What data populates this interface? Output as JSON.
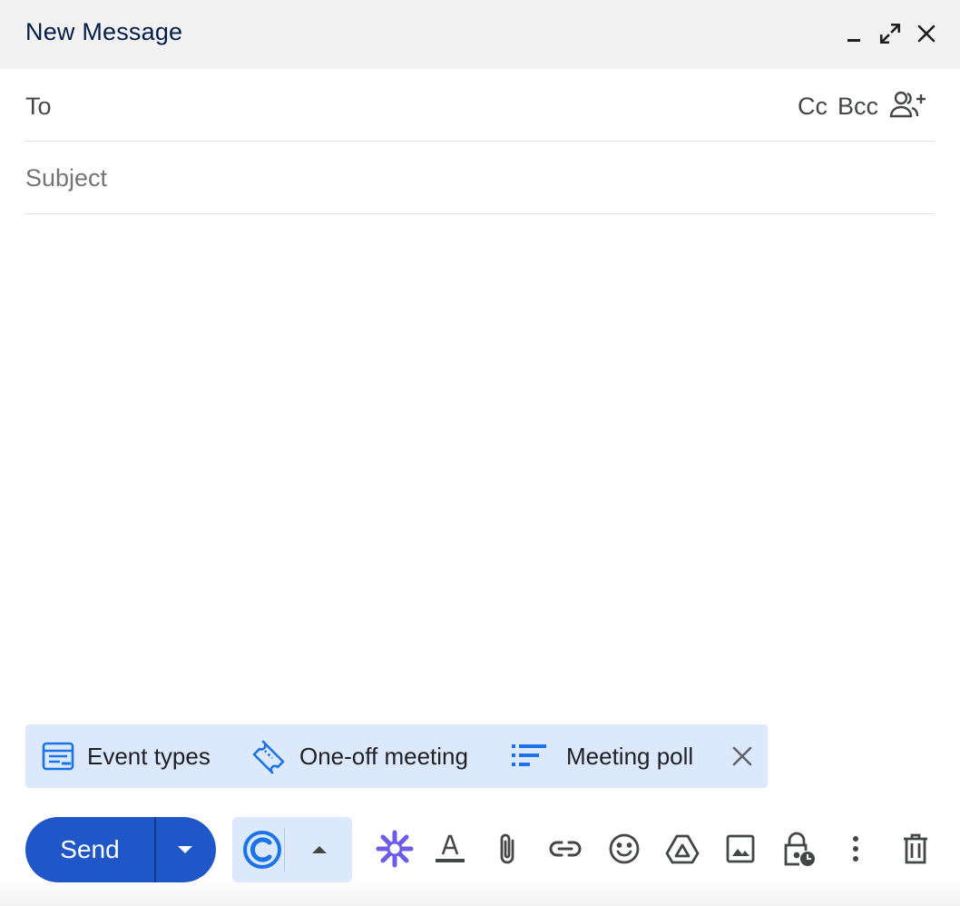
{
  "header": {
    "title": "New Message",
    "minimize_icon": "minimize-icon",
    "fullscreen_icon": "expand-icon",
    "close_icon": "close-icon"
  },
  "recipients": {
    "to_label": "To",
    "to_value": "",
    "cc_label": "Cc",
    "bcc_label": "Bcc",
    "add_recipients_icon": "people-add-icon"
  },
  "subject": {
    "placeholder": "Subject",
    "value": ""
  },
  "body": {
    "value": ""
  },
  "calendly_bar": {
    "items": [
      {
        "label": "Event types",
        "icon": "event-types-icon"
      },
      {
        "label": "One-off meeting",
        "icon": "ticket-icon"
      },
      {
        "label": "Meeting poll",
        "icon": "poll-list-icon"
      }
    ],
    "close_icon": "close-icon"
  },
  "toolbar": {
    "send_label": "Send",
    "send_options_icon": "caret-down-icon",
    "calendly_icon": "calendly-logo-icon",
    "calendly_toggle_icon": "caret-up-icon",
    "tools": [
      "ai-spark-icon",
      "text-format-icon",
      "attach-icon",
      "link-icon",
      "emoji-icon",
      "drive-icon",
      "image-icon",
      "confidential-lock-icon",
      "more-options-icon",
      "trash-icon"
    ]
  },
  "colors": {
    "header_bg": "#f2f2f2",
    "title": "#041e49",
    "send_button": "#1f57c9",
    "calendly_bg": "#dce8fb",
    "calendly_blue": "#1a73e8",
    "spark_purple": "#6c5ce7"
  }
}
